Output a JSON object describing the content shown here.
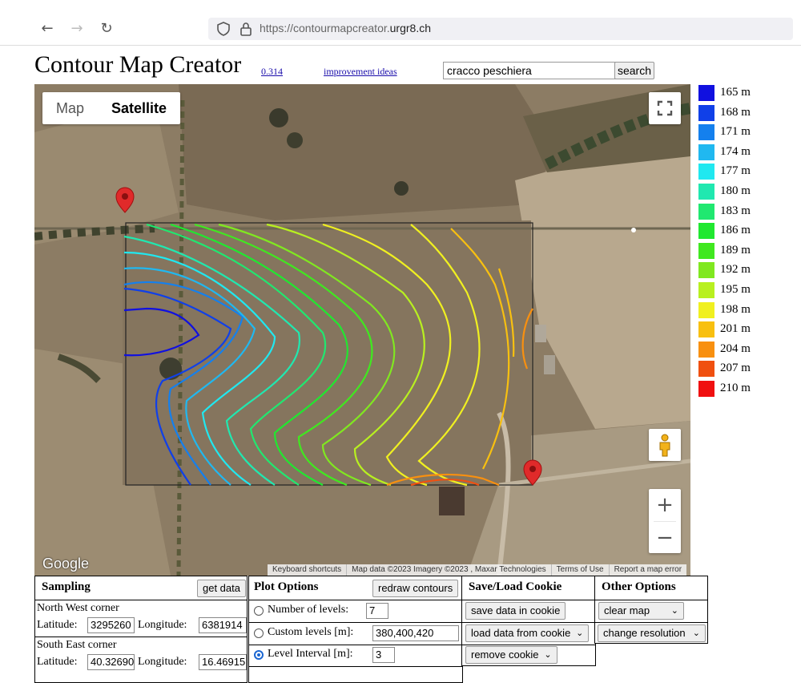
{
  "browser": {
    "url_prefix": "https://contourmapcreator.",
    "url_domain": "urgr8.ch"
  },
  "header": {
    "title": "Contour Map Creator",
    "version": "0.314",
    "ideas_link": "improvement ideas",
    "search_value": "cracco peschiera",
    "search_button": "search"
  },
  "map": {
    "type_map": "Map",
    "type_satellite": "Satellite",
    "selected_type": "Satellite",
    "google": "Google",
    "attribution": [
      "Keyboard shortcuts",
      "Map data ©2023 Imagery ©2023 , Maxar Technologies",
      "Terms of Use",
      "Report a map error"
    ]
  },
  "legend": [
    {
      "label": "165 m",
      "color": "#1010e0"
    },
    {
      "label": "168 m",
      "color": "#1040e8"
    },
    {
      "label": "171 m",
      "color": "#1480ee"
    },
    {
      "label": "174 m",
      "color": "#20b8f0"
    },
    {
      "label": "177 m",
      "color": "#20e8f0"
    },
    {
      "label": "180 m",
      "color": "#20e8b0"
    },
    {
      "label": "183 m",
      "color": "#20e870"
    },
    {
      "label": "186 m",
      "color": "#20e830"
    },
    {
      "label": "189 m",
      "color": "#40e820"
    },
    {
      "label": "192 m",
      "color": "#80e820"
    },
    {
      "label": "195 m",
      "color": "#b8f020"
    },
    {
      "label": "198 m",
      "color": "#f0f020"
    },
    {
      "label": "201 m",
      "color": "#f8c010"
    },
    {
      "label": "204 m",
      "color": "#f89010"
    },
    {
      "label": "207 m",
      "color": "#f05010"
    },
    {
      "label": "210 m",
      "color": "#f01010"
    }
  ],
  "sampling": {
    "title": "Sampling",
    "get_data": "get data",
    "nw_label": "North West corner",
    "se_label": "South East corner",
    "lat_label": "Latitude:",
    "lon_label": "Longitude:",
    "nw_lat": "3295260",
    "nw_lon": "6381914",
    "se_lat": "40.32690",
    "se_lon": "16.46915"
  },
  "plot": {
    "title": "Plot Options",
    "redraw": "redraw contours",
    "num_levels_label": "Number of levels:",
    "num_levels": "7",
    "custom_label": "Custom levels [m]:",
    "custom_levels": "380,400,420",
    "interval_label": "Level Interval [m]:",
    "interval": "3",
    "selected": "Level Interval [m]:"
  },
  "cookie": {
    "title": "Save/Load Cookie",
    "save": "save data in cookie",
    "load": "load data from cookie",
    "remove": "remove cookie"
  },
  "other": {
    "title": "Other Options",
    "clear": "clear map",
    "resolution": "change resolution"
  }
}
